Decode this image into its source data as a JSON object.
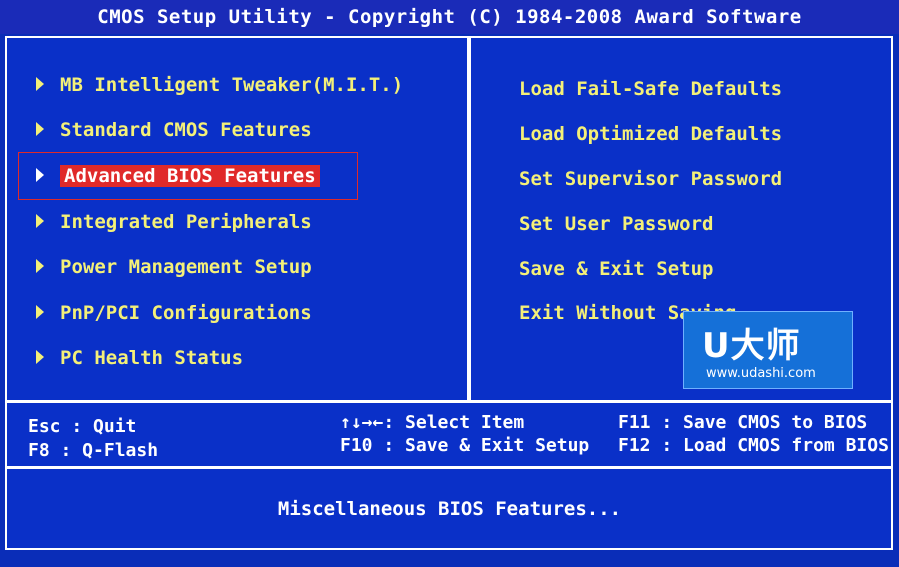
{
  "window": {
    "title": "CMOS Setup Utility - Copyright (C) 1984-2008 Award Software"
  },
  "colors": {
    "background": "#0a30c8",
    "menu_text": "#f4f078",
    "selected_bg": "#e02a2a",
    "border": "#ffffff"
  },
  "left_menu": {
    "items": [
      {
        "label": "MB Intelligent Tweaker(M.I.T.)",
        "icon": "triangle-right-icon"
      },
      {
        "label": "Standard CMOS Features",
        "icon": "triangle-right-icon"
      },
      {
        "label": "Advanced BIOS Features",
        "icon": "triangle-right-icon",
        "selected": true
      },
      {
        "label": "Integrated Peripherals",
        "icon": "triangle-right-icon"
      },
      {
        "label": "Power Management Setup",
        "icon": "triangle-right-icon"
      },
      {
        "label": "PnP/PCI Configurations",
        "icon": "triangle-right-icon"
      },
      {
        "label": "PC Health Status",
        "icon": "triangle-right-icon"
      }
    ]
  },
  "right_menu": {
    "items": [
      {
        "label": "Load Fail-Safe Defaults"
      },
      {
        "label": "Load Optimized Defaults"
      },
      {
        "label": "Set Supervisor Password"
      },
      {
        "label": "Set User Password"
      },
      {
        "label": "Save & Exit Setup"
      },
      {
        "label": "Exit Without Saving"
      }
    ]
  },
  "help": {
    "esc": "Esc : Quit",
    "f8": "F8  : Q-Flash",
    "arrows": "↑↓→←: Select Item",
    "f10": "F10 : Save & Exit Setup",
    "f11": "F11 : Save CMOS to BIOS",
    "f12": "F12 : Load CMOS from BIOS"
  },
  "status": {
    "description": "Miscellaneous BIOS Features..."
  },
  "watermark": {
    "brand": "U大师",
    "url": "www.udashi.com"
  }
}
